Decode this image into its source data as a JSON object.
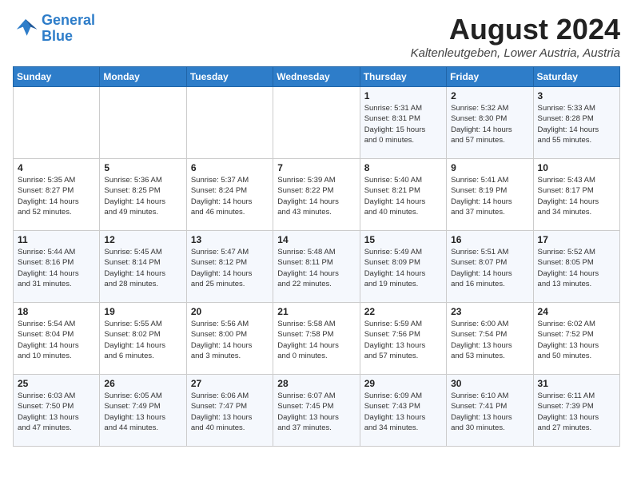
{
  "header": {
    "logo_line1": "General",
    "logo_line2": "Blue",
    "month": "August 2024",
    "location": "Kaltenleutgeben, Lower Austria, Austria"
  },
  "weekdays": [
    "Sunday",
    "Monday",
    "Tuesday",
    "Wednesday",
    "Thursday",
    "Friday",
    "Saturday"
  ],
  "weeks": [
    [
      {
        "day": "",
        "info": ""
      },
      {
        "day": "",
        "info": ""
      },
      {
        "day": "",
        "info": ""
      },
      {
        "day": "",
        "info": ""
      },
      {
        "day": "1",
        "info": "Sunrise: 5:31 AM\nSunset: 8:31 PM\nDaylight: 15 hours\nand 0 minutes."
      },
      {
        "day": "2",
        "info": "Sunrise: 5:32 AM\nSunset: 8:30 PM\nDaylight: 14 hours\nand 57 minutes."
      },
      {
        "day": "3",
        "info": "Sunrise: 5:33 AM\nSunset: 8:28 PM\nDaylight: 14 hours\nand 55 minutes."
      }
    ],
    [
      {
        "day": "4",
        "info": "Sunrise: 5:35 AM\nSunset: 8:27 PM\nDaylight: 14 hours\nand 52 minutes."
      },
      {
        "day": "5",
        "info": "Sunrise: 5:36 AM\nSunset: 8:25 PM\nDaylight: 14 hours\nand 49 minutes."
      },
      {
        "day": "6",
        "info": "Sunrise: 5:37 AM\nSunset: 8:24 PM\nDaylight: 14 hours\nand 46 minutes."
      },
      {
        "day": "7",
        "info": "Sunrise: 5:39 AM\nSunset: 8:22 PM\nDaylight: 14 hours\nand 43 minutes."
      },
      {
        "day": "8",
        "info": "Sunrise: 5:40 AM\nSunset: 8:21 PM\nDaylight: 14 hours\nand 40 minutes."
      },
      {
        "day": "9",
        "info": "Sunrise: 5:41 AM\nSunset: 8:19 PM\nDaylight: 14 hours\nand 37 minutes."
      },
      {
        "day": "10",
        "info": "Sunrise: 5:43 AM\nSunset: 8:17 PM\nDaylight: 14 hours\nand 34 minutes."
      }
    ],
    [
      {
        "day": "11",
        "info": "Sunrise: 5:44 AM\nSunset: 8:16 PM\nDaylight: 14 hours\nand 31 minutes."
      },
      {
        "day": "12",
        "info": "Sunrise: 5:45 AM\nSunset: 8:14 PM\nDaylight: 14 hours\nand 28 minutes."
      },
      {
        "day": "13",
        "info": "Sunrise: 5:47 AM\nSunset: 8:12 PM\nDaylight: 14 hours\nand 25 minutes."
      },
      {
        "day": "14",
        "info": "Sunrise: 5:48 AM\nSunset: 8:11 PM\nDaylight: 14 hours\nand 22 minutes."
      },
      {
        "day": "15",
        "info": "Sunrise: 5:49 AM\nSunset: 8:09 PM\nDaylight: 14 hours\nand 19 minutes."
      },
      {
        "day": "16",
        "info": "Sunrise: 5:51 AM\nSunset: 8:07 PM\nDaylight: 14 hours\nand 16 minutes."
      },
      {
        "day": "17",
        "info": "Sunrise: 5:52 AM\nSunset: 8:05 PM\nDaylight: 14 hours\nand 13 minutes."
      }
    ],
    [
      {
        "day": "18",
        "info": "Sunrise: 5:54 AM\nSunset: 8:04 PM\nDaylight: 14 hours\nand 10 minutes."
      },
      {
        "day": "19",
        "info": "Sunrise: 5:55 AM\nSunset: 8:02 PM\nDaylight: 14 hours\nand 6 minutes."
      },
      {
        "day": "20",
        "info": "Sunrise: 5:56 AM\nSunset: 8:00 PM\nDaylight: 14 hours\nand 3 minutes."
      },
      {
        "day": "21",
        "info": "Sunrise: 5:58 AM\nSunset: 7:58 PM\nDaylight: 14 hours\nand 0 minutes."
      },
      {
        "day": "22",
        "info": "Sunrise: 5:59 AM\nSunset: 7:56 PM\nDaylight: 13 hours\nand 57 minutes."
      },
      {
        "day": "23",
        "info": "Sunrise: 6:00 AM\nSunset: 7:54 PM\nDaylight: 13 hours\nand 53 minutes."
      },
      {
        "day": "24",
        "info": "Sunrise: 6:02 AM\nSunset: 7:52 PM\nDaylight: 13 hours\nand 50 minutes."
      }
    ],
    [
      {
        "day": "25",
        "info": "Sunrise: 6:03 AM\nSunset: 7:50 PM\nDaylight: 13 hours\nand 47 minutes."
      },
      {
        "day": "26",
        "info": "Sunrise: 6:05 AM\nSunset: 7:49 PM\nDaylight: 13 hours\nand 44 minutes."
      },
      {
        "day": "27",
        "info": "Sunrise: 6:06 AM\nSunset: 7:47 PM\nDaylight: 13 hours\nand 40 minutes."
      },
      {
        "day": "28",
        "info": "Sunrise: 6:07 AM\nSunset: 7:45 PM\nDaylight: 13 hours\nand 37 minutes."
      },
      {
        "day": "29",
        "info": "Sunrise: 6:09 AM\nSunset: 7:43 PM\nDaylight: 13 hours\nand 34 minutes."
      },
      {
        "day": "30",
        "info": "Sunrise: 6:10 AM\nSunset: 7:41 PM\nDaylight: 13 hours\nand 30 minutes."
      },
      {
        "day": "31",
        "info": "Sunrise: 6:11 AM\nSunset: 7:39 PM\nDaylight: 13 hours\nand 27 minutes."
      }
    ]
  ]
}
